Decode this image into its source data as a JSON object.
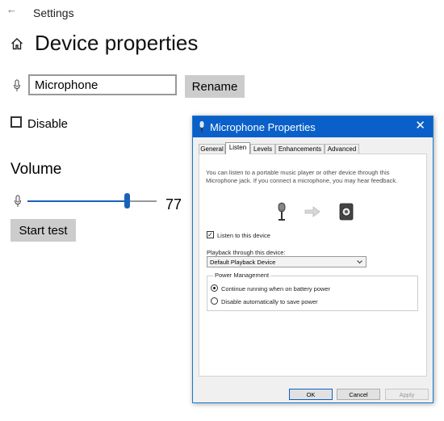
{
  "app": {
    "title": "Settings"
  },
  "page": {
    "title": "Device properties"
  },
  "device_name": {
    "value": "Microphone"
  },
  "rename_button": {
    "label": "Rename"
  },
  "disable": {
    "label": "Disable",
    "checked": false
  },
  "volume": {
    "heading": "Volume",
    "value": "77",
    "level": 0.77
  },
  "start_test_button": {
    "label": "Start test"
  },
  "dialog": {
    "title": "Microphone Properties",
    "tabs": [
      {
        "label": "General",
        "active": false
      },
      {
        "label": "Listen",
        "active": true
      },
      {
        "label": "Levels",
        "active": false
      },
      {
        "label": "Enhancements",
        "active": false
      },
      {
        "label": "Advanced",
        "active": false
      }
    ],
    "description": "You can listen to a portable music player or other device through this Microphone jack.  If you connect a microphone, you may hear feedback.",
    "listen_checkbox": {
      "label": "Listen to this device",
      "checked": true
    },
    "playback": {
      "label": "Playback through this device:",
      "value": "Default Playback Device"
    },
    "power_management": {
      "legend": "Power Management",
      "options": [
        {
          "label": "Continue running when on battery power",
          "selected": true
        },
        {
          "label": "Disable automatically to save power",
          "selected": false
        }
      ]
    },
    "buttons": {
      "ok": "OK",
      "cancel": "Cancel",
      "apply": "Apply"
    }
  },
  "colors": {
    "accent": "#0a60c8",
    "slider": "#1a62b8",
    "button_gray": "#cccccc"
  }
}
